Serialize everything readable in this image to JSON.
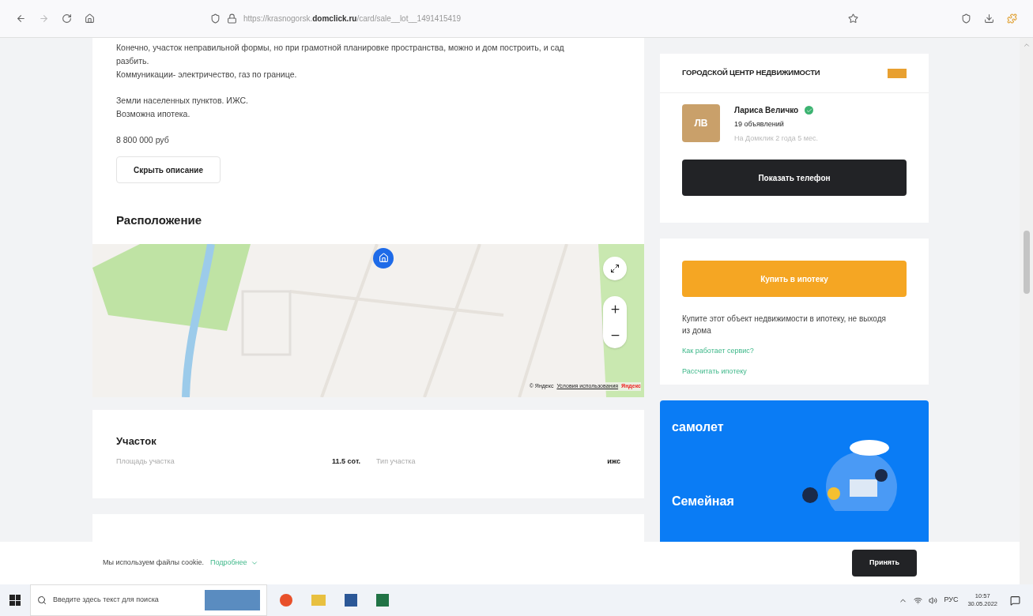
{
  "browser": {
    "url_host": "https://krasnogorsk.",
    "url_domain": "domclick.ru",
    "url_path": "/card/sale__lot__1491415419"
  },
  "description": {
    "paragraphs": [
      [
        "Конечно, участок неправильной формы, но при грамотной планировке пространства, можно и дом построить, и сад разбить.",
        "Коммуникации- электричество, газ по границе."
      ],
      [
        "Земли населенных пунктов. ИЖС.",
        "Возможна ипотека."
      ],
      [
        "8 800 000 руб"
      ]
    ],
    "hide_button": "Скрыть описание"
  },
  "location": {
    "title": "Расположение",
    "attribution": "© Яндекс",
    "terms_link": "Условия использования",
    "brand": "Яндекс"
  },
  "plot": {
    "title": "Участок",
    "fields": [
      {
        "label": "Площадь участка",
        "value": "11.5 сот."
      },
      {
        "label": "Тип участка",
        "value": "ижс"
      }
    ]
  },
  "agency": {
    "name": "ГОРОДСКОЙ ЦЕНТР НЕДВИЖИМОСТИ",
    "agent": {
      "initials": "ЛВ",
      "name": "Лариса Величко",
      "verified": true,
      "listings": "19 объявлений",
      "tenure": "На Домклик 2 года 5 мес."
    },
    "phone_button": "Показать телефон"
  },
  "mortgage": {
    "button": "Купить в ипотеку",
    "text": "Купите этот объект недвижимости в ипотеку, не выходя из дома",
    "links": [
      "Как работает сервис?",
      "Рассчитать ипотеку"
    ]
  },
  "banner": {
    "brand": "самолет",
    "headline": "Семейная"
  },
  "cookie": {
    "text": "Мы используем файлы cookie.",
    "more_link": "Подробнее",
    "accept": "Принять"
  },
  "taskbar": {
    "search_placeholder": "Введите здесь текст для поиска",
    "lang": "РУС",
    "time": "10:57",
    "date": "30.05.2022"
  }
}
